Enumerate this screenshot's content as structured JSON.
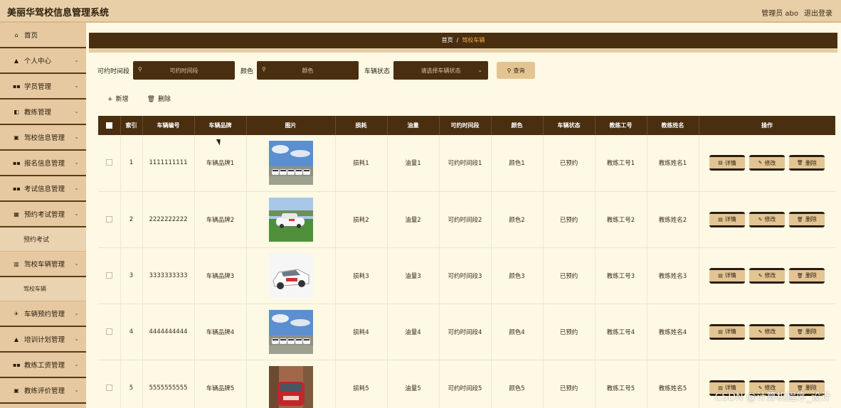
{
  "header": {
    "title": "美丽华驾校信息管理系统",
    "admin": "管理员 abo",
    "logout": "退出登录"
  },
  "sidebar": {
    "items": [
      {
        "label": "首页",
        "icon": "home-icon",
        "glyph": "⌂"
      },
      {
        "label": "个人中心",
        "icon": "user-icon",
        "glyph": "▲"
      },
      {
        "label": "学员管理",
        "icon": "grid-icon",
        "glyph": "▪▪"
      },
      {
        "label": "教练管理",
        "icon": "grid-icon",
        "glyph": "◧"
      },
      {
        "label": "驾校信息管理",
        "icon": "doc-icon",
        "glyph": "▣"
      },
      {
        "label": "报名信息管理",
        "icon": "grid-icon",
        "glyph": "▪▪"
      },
      {
        "label": "考试信息管理",
        "icon": "grid-icon",
        "glyph": "▪▪"
      },
      {
        "label": "预约考试管理",
        "icon": "table-icon",
        "glyph": "▦"
      },
      {
        "sub": "预约考试"
      },
      {
        "label": "驾校车辆管理",
        "icon": "bar-icon",
        "glyph": "▥"
      },
      {
        "sub": "驾校车辆"
      },
      {
        "label": "车辆预约管理",
        "icon": "plane-icon",
        "glyph": "✈"
      },
      {
        "label": "培训计划管理",
        "icon": "user-icon",
        "glyph": "▲"
      },
      {
        "label": "教练工资管理",
        "icon": "grid-icon",
        "glyph": "▪▪"
      },
      {
        "label": "教练评价管理",
        "icon": "doc-icon",
        "glyph": "▣"
      }
    ]
  },
  "breadcrumb": {
    "home": "首页",
    "sep": "/",
    "current": "驾校车辆"
  },
  "search": {
    "time_label": "可约时间段",
    "time_placeholder": "可约时间段",
    "color_label": "颜色",
    "color_placeholder": "颜色",
    "status_label": "车辆状态",
    "status_placeholder": "请选择车辆状态",
    "query_button": "查询"
  },
  "actions": {
    "add": "新增",
    "delete": "删除"
  },
  "table": {
    "headers": [
      "索引",
      "车辆编号",
      "车辆品牌",
      "图片",
      "损耗",
      "油量",
      "可约时间段",
      "颜色",
      "车辆状态",
      "教练工号",
      "教练姓名",
      "操作"
    ],
    "rows": [
      {
        "idx": "1",
        "no": "1111111111",
        "brand": "车辆品牌1",
        "loss": "损耗1",
        "oil": "油量1",
        "time": "可约时间段1",
        "color": "颜色1",
        "status": "已预约",
        "coach_no": "教练工号1",
        "coach_name": "教练姓名1",
        "photo": "fleet"
      },
      {
        "idx": "2",
        "no": "2222222222",
        "brand": "车辆品牌2",
        "loss": "损耗2",
        "oil": "油量2",
        "time": "可约时间段2",
        "color": "颜色2",
        "status": "已预约",
        "coach_no": "教练工号2",
        "coach_name": "教练姓名2",
        "photo": "grass"
      },
      {
        "idx": "3",
        "no": "3333333333",
        "brand": "车辆品牌3",
        "loss": "损耗3",
        "oil": "油量3",
        "time": "可约时间段3",
        "color": "颜色3",
        "status": "已预约",
        "coach_no": "教练工号3",
        "coach_name": "教练姓名3",
        "photo": "white"
      },
      {
        "idx": "4",
        "no": "4444444444",
        "brand": "车辆品牌4",
        "loss": "损耗4",
        "oil": "油量4",
        "time": "可约时间段4",
        "color": "颜色4",
        "status": "已预约",
        "coach_no": "教练工号4",
        "coach_name": "教练姓名4",
        "photo": "fleet"
      },
      {
        "idx": "5",
        "no": "5555555555",
        "brand": "车辆品牌5",
        "loss": "损耗5",
        "oil": "油量5",
        "time": "可约时间段5",
        "color": "颜色5",
        "status": "已预约",
        "coach_no": "教练工号5",
        "coach_name": "教练姓名5",
        "photo": "red"
      }
    ],
    "ops": {
      "detail": "详情",
      "edit": "修改",
      "delete": "删除"
    }
  },
  "watermark": "CSDN @计算机程序_设计",
  "colors": {
    "dark": "#4a2e10",
    "accent": "#f0b24a",
    "button": "#e3c593",
    "sidebar": "#e6c9a1",
    "page": "#fdf9e4"
  }
}
